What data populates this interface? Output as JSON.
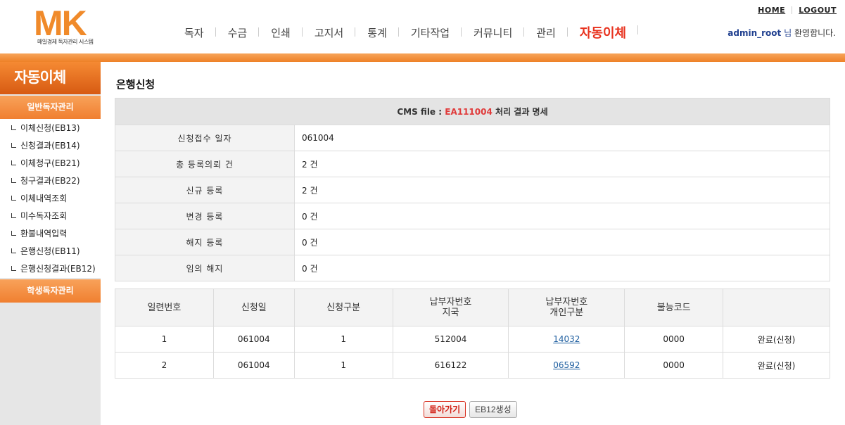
{
  "header": {
    "logo_text": "MK",
    "logo_sub": "매일경제 독자관리 시스템",
    "nav": [
      "독자",
      "수금",
      "인쇄",
      "고지서",
      "통계",
      "기타작업",
      "커뮤니티",
      "관리",
      "자동이체"
    ],
    "home": "HOME",
    "logout": "LOGOUT",
    "user": "admin_root",
    "user_suffix": "님",
    "welcome": "환영합니다."
  },
  "sidebar": {
    "title": "자동이체",
    "cat1": "일반독자관리",
    "items": [
      "이체신청(EB13)",
      "신청결과(EB14)",
      "이체청구(EB21)",
      "청구결과(EB22)",
      "이체내역조회",
      "미수독자조회",
      "환불내역입력",
      "은행신청(EB11)",
      "은행신청결과(EB12)"
    ],
    "cat2": "학생독자관리"
  },
  "main": {
    "title": "은행신청",
    "file_prefix": "CMS file :",
    "file_name": "EA111004",
    "file_suffix": "처리 결과 명세",
    "info": [
      {
        "label": "신청접수 일자",
        "value": "061004"
      },
      {
        "label": "총 등록의뢰 건",
        "value": "2 건"
      },
      {
        "label": "신규 등록",
        "value": "2 건"
      },
      {
        "label": "변경 등록",
        "value": "0 건"
      },
      {
        "label": "해지 등록",
        "value": "0 건"
      },
      {
        "label": "임의 해지",
        "value": "0 건"
      }
    ],
    "columns": {
      "seq": "일련번호",
      "date": "신청일",
      "type": "신청구분",
      "payer_1": "납부자번호",
      "payer_2": "지국",
      "pid_1": "납부자번호",
      "pid_2": "개인구분",
      "fail": "불능코드",
      "status": ""
    },
    "rows": [
      {
        "seq": "1",
        "date": "061004",
        "type": "1",
        "branch": "512004",
        "personal": "14032",
        "fail": "0000",
        "status": "완료(신청)"
      },
      {
        "seq": "2",
        "date": "061004",
        "type": "1",
        "branch": "616122",
        "personal": "06592",
        "fail": "0000",
        "status": "완료(신청)"
      }
    ],
    "buttons": {
      "back": "돌아가기",
      "generate": "EB12생성"
    }
  }
}
